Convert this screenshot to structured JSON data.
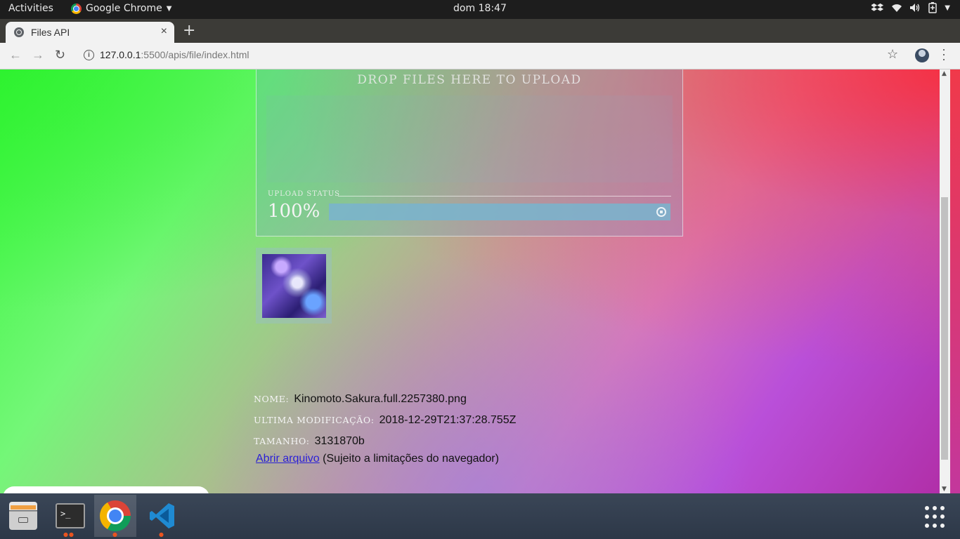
{
  "topbar": {
    "activities": "Activities",
    "app_name": "Google Chrome",
    "clock": "dom 18:47",
    "tray_icons": [
      "dropbox-icon",
      "wifi-icon",
      "volume-icon",
      "battery-icon",
      "power-menu-icon"
    ]
  },
  "browser": {
    "tab_title": "Files API",
    "tab_close": "×",
    "new_tab": "+",
    "url_host": "127.0.0.1",
    "url_rest": ":5500/apis/file/index.html",
    "info_glyph": "i"
  },
  "page": {
    "drop_hint": "DROP FILES HERE TO UPLOAD",
    "upload_status_label": "UPLOAD STATUS",
    "progress_text": "100%",
    "progress_value": 1.0,
    "file": {
      "name_label": "NOME:",
      "name": "Kinomoto.Sakura.full.2257380.png",
      "modified_label": "ULTIMA MODIFICAÇÃO:",
      "modified": "2018-12-29T21:37:28.755Z",
      "size_label": "TAMANHO:",
      "size": "3131870b"
    },
    "open_link": "Abrir arquivo",
    "open_note": "(Sujeito a limitações do navegador)"
  },
  "dock": {
    "items": [
      "files-icon",
      "terminal-icon",
      "chrome-icon",
      "vscode-icon"
    ],
    "terminal_prompt": ">_"
  },
  "colors": {
    "accent_ubuntu": "#e95420",
    "link": "#2a1fd6"
  }
}
